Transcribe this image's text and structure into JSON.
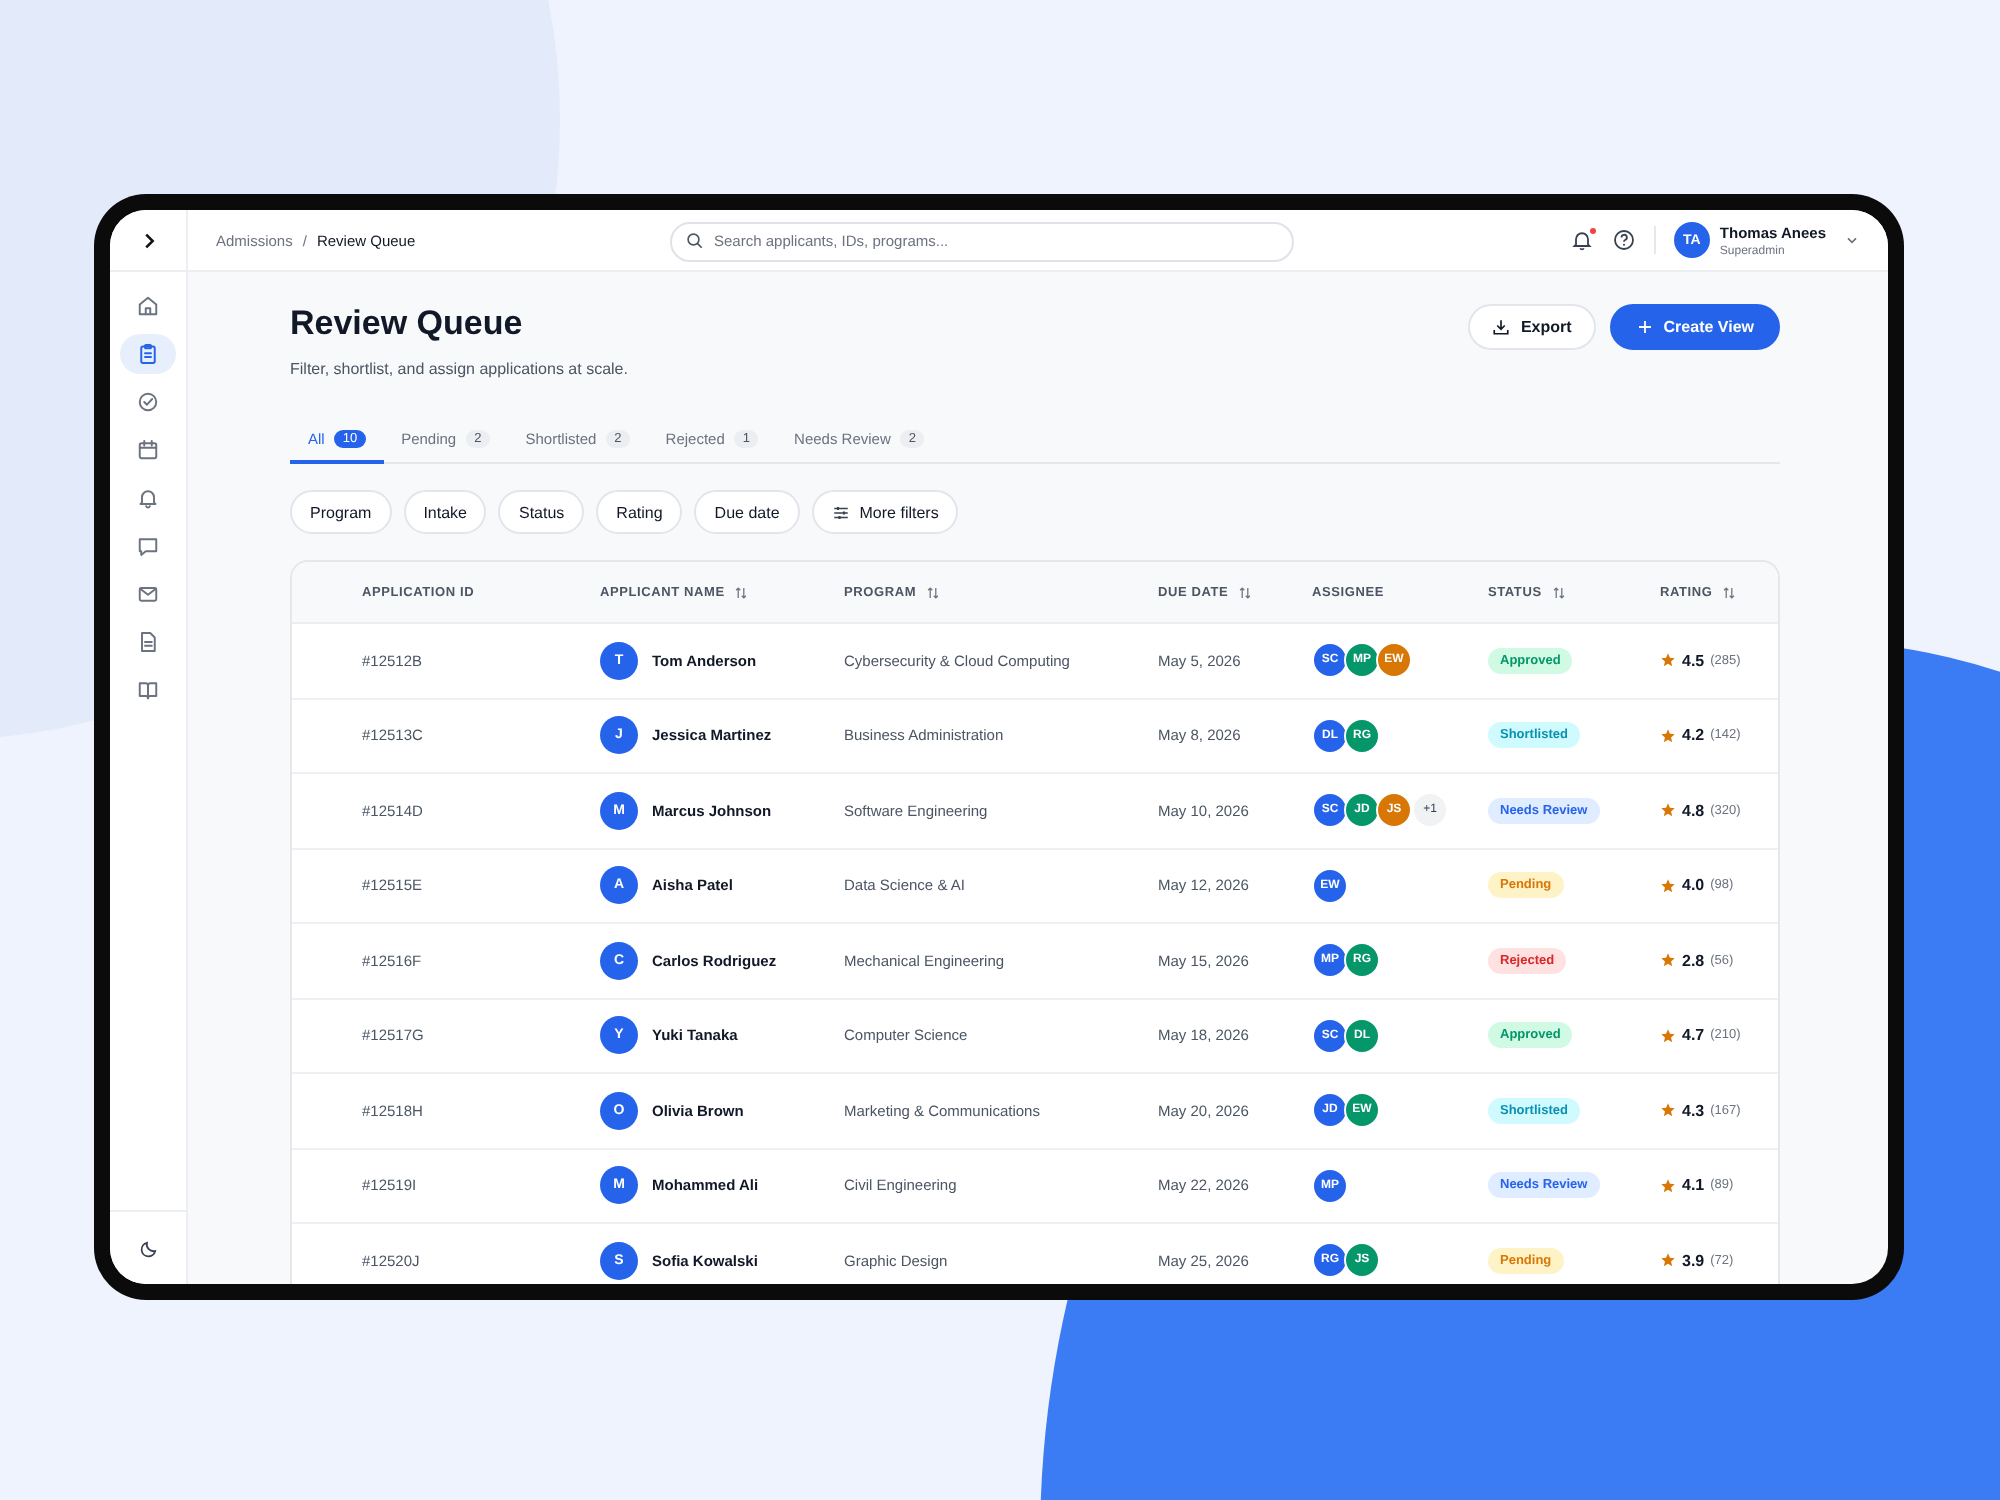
{
  "topbar": {
    "breadcrumb": [
      "Admissions",
      "Review Queue"
    ],
    "separator": "/",
    "search": {
      "placeholder": "Search applicants, IDs, programs..."
    },
    "notifications_unread": true,
    "user": {
      "initials": "TA",
      "name": "Thomas Anees",
      "role": "Superadmin"
    }
  },
  "sidebar": {
    "items": [
      {
        "kind": "home",
        "selected": false
      },
      {
        "kind": "clipboard",
        "selected": true
      },
      {
        "kind": "check",
        "selected": false
      },
      {
        "kind": "calendar",
        "selected": false
      },
      {
        "kind": "bell",
        "selected": false
      },
      {
        "kind": "chat",
        "selected": false
      },
      {
        "kind": "mail",
        "selected": false
      },
      {
        "kind": "document",
        "selected": false
      },
      {
        "kind": "book",
        "selected": false
      }
    ]
  },
  "page": {
    "title": "Review Queue",
    "subtitle": "Filter, shortlist, and assign applications at scale.",
    "buttons": [
      {
        "kind": "export",
        "label": "Export"
      },
      {
        "kind": "create",
        "label": "Create View"
      }
    ]
  },
  "tabs": [
    {
      "label": "All",
      "count": "10",
      "selected": true
    },
    {
      "label": "Pending",
      "count": "2",
      "selected": false
    },
    {
      "label": "Shortlisted",
      "count": "2",
      "selected": false
    },
    {
      "label": "Rejected",
      "count": "1",
      "selected": false
    },
    {
      "label": "Needs Review",
      "count": "2",
      "selected": false
    }
  ],
  "filters": [
    {
      "label": "Program",
      "kind": "plain"
    },
    {
      "label": "Intake",
      "kind": "plain"
    },
    {
      "label": "Status",
      "kind": "plain"
    },
    {
      "label": "Rating",
      "kind": "plain"
    },
    {
      "label": "Due date",
      "kind": "plain"
    },
    {
      "label": "More filters",
      "kind": "more"
    }
  ],
  "table": {
    "columns": [
      {
        "label": "APPLICATION ID",
        "sortable": false
      },
      {
        "label": "APPLICANT NAME",
        "sortable": true
      },
      {
        "label": "PROGRAM",
        "sortable": true
      },
      {
        "label": "DUE DATE",
        "sortable": true
      },
      {
        "label": "ASSIGNEE",
        "sortable": false
      },
      {
        "label": "STATUS",
        "sortable": true
      },
      {
        "label": "RATING",
        "sortable": true
      }
    ],
    "rows": [
      {
        "id": "#12512B",
        "initial": "T",
        "name": "Tom Anderson",
        "program": "Cybersecurity & Cloud Computing",
        "due": "May 5, 2026",
        "assignees": [
          {
            "initials": "SC",
            "color": "#2563eb"
          },
          {
            "initials": "MP",
            "color": "#059669"
          },
          {
            "initials": "EW",
            "color": "#d97706"
          }
        ],
        "status": {
          "label": "Approved",
          "kind": "approved"
        },
        "rating": "4.5",
        "reviews": "(285)"
      },
      {
        "id": "#12513C",
        "initial": "J",
        "name": "Jessica Martinez",
        "program": "Business Administration",
        "due": "May 8, 2026",
        "assignees": [
          {
            "initials": "DL",
            "color": "#2563eb"
          },
          {
            "initials": "RG",
            "color": "#059669"
          }
        ],
        "status": {
          "label": "Shortlisted",
          "kind": "shortlisted"
        },
        "rating": "4.2",
        "reviews": "(142)"
      },
      {
        "id": "#12514D",
        "initial": "M",
        "name": "Marcus Johnson",
        "program": "Software Engineering",
        "due": "May 10, 2026",
        "assignees": [
          {
            "initials": "SC",
            "color": "#2563eb"
          },
          {
            "initials": "JD",
            "color": "#059669"
          },
          {
            "initials": "JS",
            "color": "#d97706"
          }
        ],
        "more": "+1",
        "status": {
          "label": "Needs Review",
          "kind": "review"
        },
        "rating": "4.8",
        "reviews": "(320)"
      },
      {
        "id": "#12515E",
        "initial": "A",
        "name": "Aisha Patel",
        "program": "Data Science & AI",
        "due": "May 12, 2026",
        "assignees": [
          {
            "initials": "EW",
            "color": "#2563eb"
          }
        ],
        "status": {
          "label": "Pending",
          "kind": "pending"
        },
        "rating": "4.0",
        "reviews": "(98)"
      },
      {
        "id": "#12516F",
        "initial": "C",
        "name": "Carlos Rodriguez",
        "program": "Mechanical Engineering",
        "due": "May 15, 2026",
        "assignees": [
          {
            "initials": "MP",
            "color": "#2563eb"
          },
          {
            "initials": "RG",
            "color": "#059669"
          }
        ],
        "status": {
          "label": "Rejected",
          "kind": "rejected"
        },
        "rating": "2.8",
        "reviews": "(56)"
      },
      {
        "id": "#12517G",
        "initial": "Y",
        "name": "Yuki Tanaka",
        "program": "Computer Science",
        "due": "May 18, 2026",
        "assignees": [
          {
            "initials": "SC",
            "color": "#2563eb"
          },
          {
            "initials": "DL",
            "color": "#059669"
          }
        ],
        "status": {
          "label": "Approved",
          "kind": "approved"
        },
        "rating": "4.7",
        "reviews": "(210)"
      },
      {
        "id": "#12518H",
        "initial": "O",
        "name": "Olivia Brown",
        "program": "Marketing & Communications",
        "due": "May 20, 2026",
        "assignees": [
          {
            "initials": "JD",
            "color": "#2563eb"
          },
          {
            "initials": "EW",
            "color": "#059669"
          }
        ],
        "status": {
          "label": "Shortlisted",
          "kind": "shortlisted"
        },
        "rating": "4.3",
        "reviews": "(167)"
      },
      {
        "id": "#12519I",
        "initial": "M",
        "name": "Mohammed Ali",
        "program": "Civil Engineering",
        "due": "May 22, 2026",
        "assignees": [
          {
            "initials": "MP",
            "color": "#2563eb"
          }
        ],
        "status": {
          "label": "Needs Review",
          "kind": "review"
        },
        "rating": "4.1",
        "reviews": "(89)"
      },
      {
        "id": "#12520J",
        "initial": "S",
        "name": "Sofia Kowalski",
        "program": "Graphic Design",
        "due": "May 25, 2026",
        "assignees": [
          {
            "initials": "RG",
            "color": "#2563eb"
          },
          {
            "initials": "JS",
            "color": "#059669"
          }
        ],
        "status": {
          "label": "Pending",
          "kind": "pending"
        },
        "rating": "3.9",
        "reviews": "(72)"
      }
    ]
  }
}
